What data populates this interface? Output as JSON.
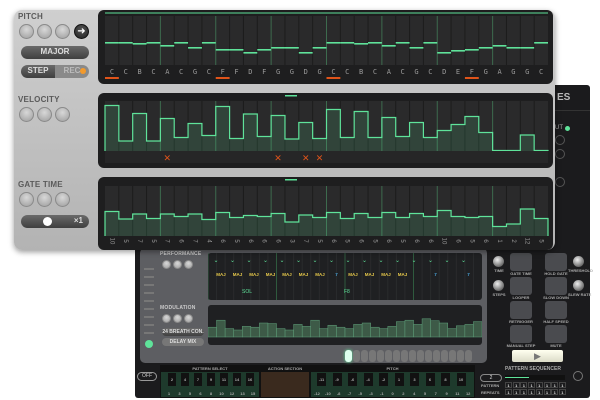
{
  "pitch": {
    "label": "PITCH",
    "scale": "MAJOR",
    "step_label": "STEP",
    "rec_label": "REC",
    "notes": [
      "C",
      "C",
      "B",
      "C",
      "A",
      "C",
      "G",
      "C",
      "F",
      "F",
      "D",
      "F",
      "G",
      "G",
      "D",
      "G",
      "C",
      "C",
      "B",
      "C",
      "A",
      "C",
      "G",
      "C",
      "D",
      "E",
      "F",
      "G",
      "A",
      "G",
      "G",
      "C"
    ],
    "marked_steps": [
      1,
      9,
      17,
      27
    ]
  },
  "velocity": {
    "label": "VELOCITY",
    "values": [
      0.91,
      0.2,
      0.75,
      0.2,
      0.65,
      0.27,
      0.55,
      0.31,
      0.89,
      0.25,
      0.74,
      0.29,
      0.71,
      0.24,
      0.57,
      0.25,
      0.83,
      0.27,
      0.79,
      0.27,
      0.67,
      0.29,
      0.57,
      0.27,
      0.41,
      0.53,
      0.69,
      0.37,
      0.01,
      0.01,
      0.32,
      0.01
    ],
    "muted_steps": [
      5,
      13,
      15,
      16
    ]
  },
  "gate": {
    "label": "GATE TIME",
    "multiplier": "×1",
    "values": [
      0.49,
      0.34,
      0.44,
      0.35,
      0.44,
      0.39,
      0.44,
      0.33,
      0.47,
      0.37,
      0.41,
      0.39,
      0.45,
      0.28,
      0.42,
      0.37,
      0.47,
      0.35,
      0.45,
      0.37,
      0.47,
      0.37,
      0.45,
      0.39,
      0.51,
      0.39,
      0.37,
      0.39,
      0.19,
      0.24,
      0.54,
      0.35
    ],
    "labels": [
      "10",
      "5",
      "7",
      "5",
      "7",
      "6",
      "7",
      "4",
      "6",
      "5",
      "6",
      "6",
      "6",
      "3",
      "7",
      "5",
      "6",
      "5",
      "6",
      "5",
      "6",
      "5",
      "6",
      "6",
      "10",
      "6",
      "5",
      "6",
      "1",
      "2",
      "12",
      "5"
    ]
  },
  "accent_green": "#5fe39a",
  "marker_orange": "#e0541a",
  "back": {
    "partial_title": "ES",
    "partial_label": "UT",
    "performance_label": "PERFORMANCE",
    "modulation_label": "MODULATION",
    "mod_source": "24 BREATH CON.",
    "mod_dest": "DELAY MIX",
    "chords": [
      "MAJ",
      "MAJ",
      "MAJ",
      "MAJ",
      "MAJ",
      "MAJ",
      "MAJ",
      "7",
      "MAJ",
      "MAJ",
      "MAJ",
      "MAJ",
      "",
      "7",
      "",
      "7"
    ],
    "perf_notes": [
      "SOL",
      "F8"
    ],
    "mod_values": [
      0.35,
      0.6,
      0.3,
      0.25,
      0.38,
      0.35,
      0.5,
      0.48,
      0.3,
      0.25,
      0.45,
      0.38,
      0.6,
      0.3,
      0.42,
      0.35,
      0.3,
      0.45,
      0.5,
      0.35,
      0.3,
      0.38,
      0.55,
      0.6,
      0.45,
      0.65,
      0.58,
      0.5,
      0.3,
      0.4,
      0.45,
      0.55
    ],
    "right_buttons": [
      {
        "knob": "TIME",
        "button": "GATE TIME"
      },
      {
        "button": "HOLD GATE",
        "knob": "THRESHOLD"
      },
      {
        "knob": "STEPS",
        "button": "LOOPER"
      },
      {
        "button": "SLOW DOWN",
        "knob": "SLEW RATE"
      },
      {
        "button": "RETRIGGER"
      },
      {
        "button": "HALF SPEED"
      },
      {
        "button": "MANUAL STEP"
      },
      {
        "button": "MUTE"
      }
    ],
    "off_label": "OFF",
    "pattern_select": "PATTERN SELECT",
    "action_section": "ACTION SECTION",
    "pitch_section": "PITCH",
    "pattern_black": [
      "2",
      "4",
      "7",
      "9",
      "11",
      "14",
      "16"
    ],
    "pattern_white": [
      "1",
      "3",
      "5",
      "6",
      "8",
      "10",
      "12",
      "13",
      "15"
    ],
    "pitch_black": [
      "-11",
      "-9",
      "-6",
      "-4",
      "-2",
      "1",
      "3",
      "6",
      "8",
      "10"
    ],
    "pitch_white": [
      "-12",
      "-10",
      "-8",
      "-7",
      "-5",
      "-3",
      "-1",
      "0",
      "2",
      "4",
      "5",
      "7",
      "9",
      "11",
      "12"
    ],
    "sequencer_label": "PATTERN SEQUENCER",
    "sequencer_value": "2",
    "pattern_row": "PATTERN",
    "repeats_row": "REPEATS",
    "pattern_cells": [
      "1",
      "1",
      "1",
      "1",
      "1",
      "1",
      "1",
      "1"
    ],
    "repeat_cells": [
      "1",
      "1",
      "1",
      "1",
      "1",
      "1",
      "1",
      "1"
    ],
    "active_step": "1"
  }
}
